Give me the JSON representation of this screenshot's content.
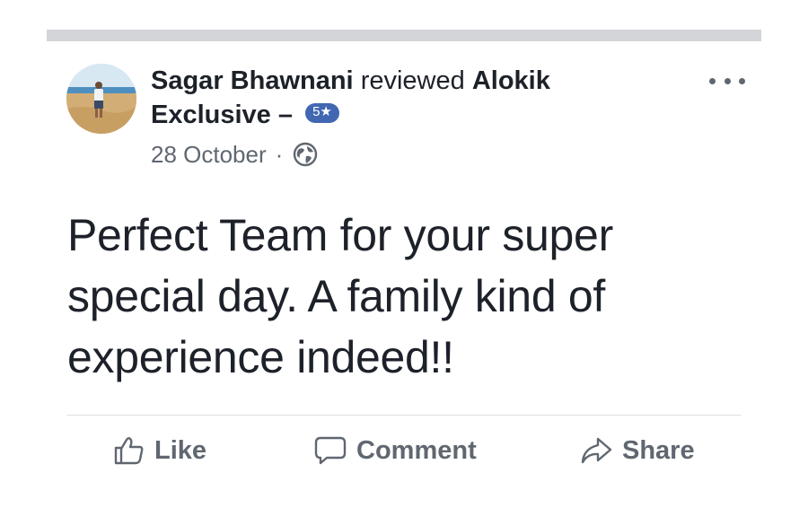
{
  "post": {
    "author": "Sagar Bhawnani",
    "verb": "reviewed",
    "page_line1": "Alokik",
    "page_line2": "Exclusive",
    "dash": "–",
    "rating": "5★",
    "date": "28 October",
    "separator": "·",
    "privacy_icon": "globe-icon",
    "body": "Perfect Team for your super special day. A family kind of experience indeed!!"
  },
  "actions": {
    "like_label": "Like",
    "comment_label": "Comment",
    "share_label": "Share"
  },
  "icons": {
    "more": "more-options-icon",
    "like": "thumbs-up-icon",
    "comment": "comment-bubble-icon",
    "share": "share-arrow-icon"
  },
  "colors": {
    "badge": "#4267b2",
    "text": "#1d2129",
    "secondary": "#606770",
    "separator_bar": "#d3d5d9"
  }
}
